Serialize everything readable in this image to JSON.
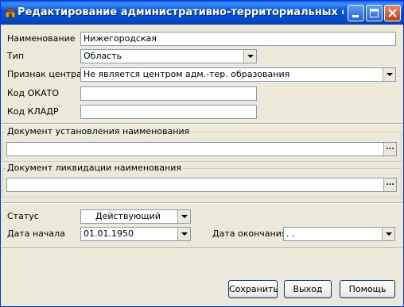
{
  "window": {
    "title": "Редактирование административно-территориальных единиц (на..."
  },
  "form": {
    "name": {
      "label": "Наименование",
      "value": "Нижегородская"
    },
    "type": {
      "label": "Тип",
      "value": "Область"
    },
    "center_flag": {
      "label": "Признак центра",
      "value": "Не является центром адм.-тер. образования"
    },
    "okato": {
      "label": "Код ОКАТО",
      "value": ""
    },
    "kladr": {
      "label": "Код КЛАДР",
      "value": ""
    }
  },
  "groups": {
    "establish_doc": {
      "label": "Документ установления наименования",
      "value": ""
    },
    "liquidation_doc": {
      "label": "Документ ликвидации наименования",
      "value": ""
    }
  },
  "status": {
    "label": "Статус",
    "value": "Действующий",
    "start_date_label": "Дата начала",
    "start_date_value": "01.01.1950",
    "end_date_label": "Дата окончания",
    "end_date_value": ". ."
  },
  "buttons": {
    "save": "Сохранить",
    "exit": "Выход",
    "help": "Помощь"
  },
  "ellipsis": "..."
}
